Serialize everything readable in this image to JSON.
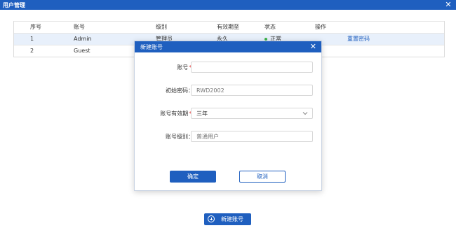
{
  "window": {
    "title": "用户管理",
    "close_glyph": "✕"
  },
  "table": {
    "headers": [
      "序号",
      "账号",
      "级别",
      "有效期至",
      "状态",
      "操作"
    ],
    "rows": [
      {
        "index": "1",
        "account": "Admin",
        "level": "管理员",
        "valid_until": "永久",
        "status": "正常",
        "action": "重置密码",
        "status_color": "#3bb24a"
      },
      {
        "index": "2",
        "account": "Guest"
      }
    ]
  },
  "dialog": {
    "title": "新建账号",
    "close_glyph": "✕",
    "fields": {
      "account": {
        "label": "账号",
        "required_mark": "*:",
        "value": ""
      },
      "password": {
        "label": "初始密码：",
        "placeholder": "RWD2002"
      },
      "validity": {
        "label": "账号有效期",
        "required_mark": "*:",
        "value": "三年"
      },
      "level": {
        "label": "账号级别：",
        "placeholder": "普通用户"
      }
    },
    "confirm_label": "确定",
    "cancel_label": "取消"
  },
  "new_account_button": {
    "label": "新建账号"
  },
  "colors": {
    "primary": "#1f5fbf",
    "selected_row": "#e8f0fb",
    "required": "#e34b4b"
  }
}
